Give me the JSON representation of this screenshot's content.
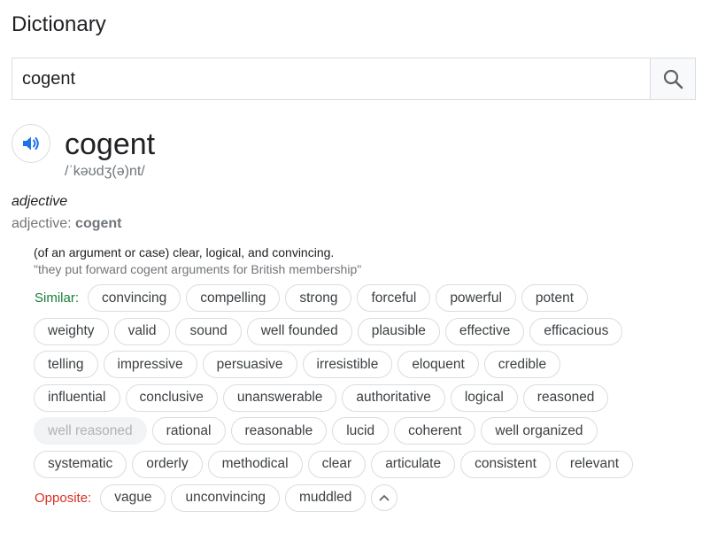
{
  "header": {
    "title": "Dictionary"
  },
  "search": {
    "value": "cogent",
    "icon": "search-icon"
  },
  "entry": {
    "word": "cogent",
    "phonetic": "/ˈkəʊdʒ(ə)nt/",
    "part_of_speech": "adjective",
    "form_label": "adjective: ",
    "form_word": "cogent",
    "definition": "(of an argument or case) clear, logical, and convincing.",
    "example": "\"they put forward cogent arguments for British membership\""
  },
  "similar_label": "Similar:",
  "similar_rows": [
    [
      "convincing",
      "compelling",
      "strong",
      "forceful",
      "powerful",
      "potent"
    ],
    [
      "weighty",
      "valid",
      "sound",
      "well founded",
      "plausible",
      "effective",
      "efficacious"
    ],
    [
      "telling",
      "impressive",
      "persuasive",
      "irresistible",
      "eloquent",
      "credible"
    ],
    [
      "influential",
      "conclusive",
      "unanswerable",
      "authoritative",
      "logical",
      "reasoned"
    ],
    [
      "well reasoned",
      "rational",
      "reasonable",
      "lucid",
      "coherent",
      "well organized"
    ],
    [
      "systematic",
      "orderly",
      "methodical",
      "clear",
      "articulate",
      "consistent",
      "relevant"
    ]
  ],
  "current_chip": "well reasoned",
  "opposite_label": "Opposite:",
  "opposites": [
    "vague",
    "unconvincing",
    "muddled"
  ],
  "colors": {
    "similar": "#188038",
    "opposite": "#d93025",
    "speaker_icon": "#1a73e8"
  }
}
